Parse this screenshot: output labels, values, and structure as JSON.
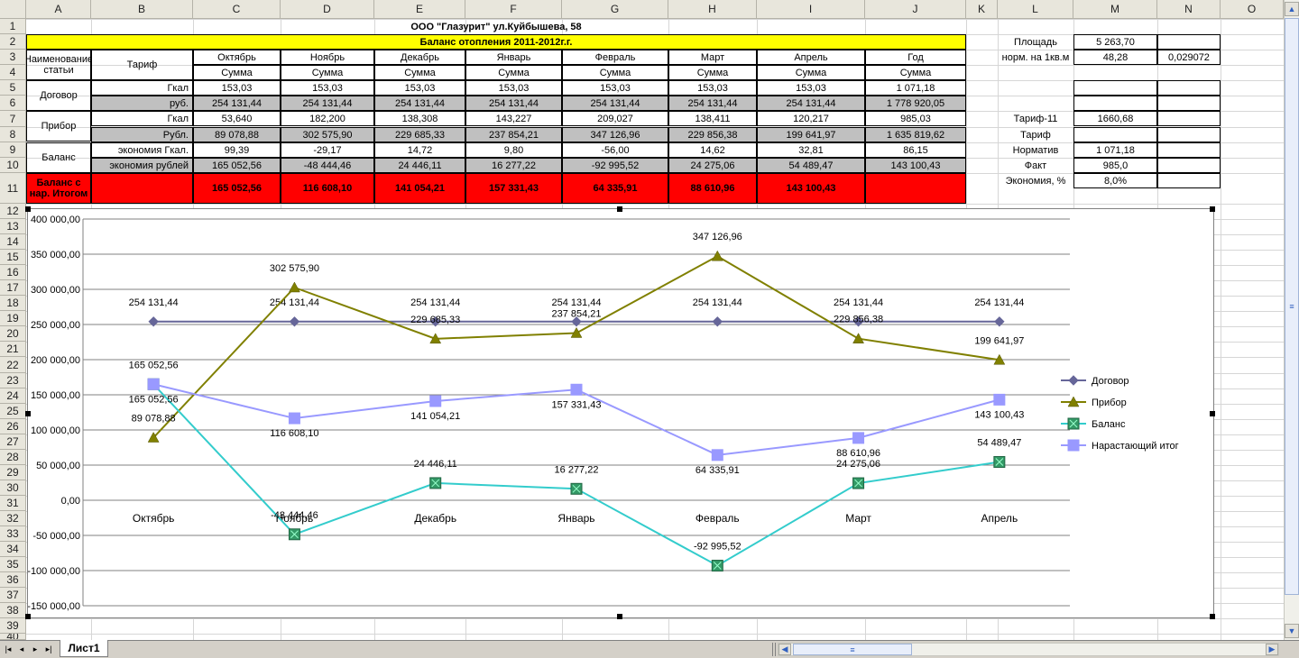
{
  "colors": {
    "header_bg": "#e8e6dc",
    "title_yellow": "#ffff00",
    "grey_row": "#c0c0c0",
    "red_row": "#ff0000",
    "dogovor": "#666699",
    "pribor": "#808000",
    "balans": "#33cccc",
    "itog": "#9999ff"
  },
  "columns": [
    "A",
    "B",
    "C",
    "D",
    "E",
    "F",
    "G",
    "H",
    "I",
    "J",
    "K",
    "L",
    "M",
    "N",
    "O"
  ],
  "rows": [
    "1",
    "2",
    "3",
    "4",
    "5",
    "6",
    "7",
    "8",
    "9",
    "10",
    "11",
    "12",
    "13",
    "14",
    "15",
    "16",
    "17",
    "18",
    "19",
    "20",
    "21",
    "22",
    "23",
    "24",
    "25",
    "26",
    "27",
    "28",
    "29",
    "30",
    "31",
    "32",
    "33",
    "34",
    "35",
    "36",
    "37",
    "38",
    "39",
    "40"
  ],
  "sheet": {
    "title": "ООО \"Глазурит\" ул.Куйбышева, 58",
    "subtitle": "Баланс отопления 2011-2012г.г.",
    "col_name": "Наименование статьи",
    "col_tariff": "Тариф",
    "months": [
      "Октябрь",
      "Ноябрь",
      "Декабрь",
      "Январь",
      "Февраль",
      "Март",
      "Апрель",
      "Год"
    ],
    "sum_label": "Сумма",
    "dogovor": {
      "label": "Договор",
      "gkal_label": "Гкал",
      "rub_label": "руб.",
      "gkal": [
        "153,03",
        "153,03",
        "153,03",
        "153,03",
        "153,03",
        "153,03",
        "153,03",
        "1 071,18"
      ],
      "rub": [
        "254 131,44",
        "254 131,44",
        "254 131,44",
        "254 131,44",
        "254 131,44",
        "254 131,44",
        "254 131,44",
        "1 778 920,05"
      ]
    },
    "pribor": {
      "label": "Прибор",
      "gkal_label": "Гкал",
      "rub_label": "Рубл.",
      "gkal": [
        "53,640",
        "182,200",
        "138,308",
        "143,227",
        "209,027",
        "138,411",
        "120,217",
        "985,03"
      ],
      "rub": [
        "89 078,88",
        "302 575,90",
        "229 685,33",
        "237 854,21",
        "347 126,96",
        "229 856,38",
        "199 641,97",
        "1 635 819,62"
      ]
    },
    "balans": {
      "label": "Баланс",
      "gkal_label": "экономия Гкал.",
      "rub_label": "экономия рублей",
      "gkal": [
        "99,39",
        "-29,17",
        "14,72",
        "9,80",
        "-56,00",
        "14,62",
        "32,81",
        "86,15"
      ],
      "rub": [
        "165 052,56",
        "-48 444,46",
        "24 446,11",
        "16 277,22",
        "-92 995,52",
        "24 275,06",
        "54 489,47",
        "143 100,43"
      ]
    },
    "itog": {
      "label": "Баланс с нар. Итогом",
      "values": [
        "165 052,56",
        "116 608,10",
        "141 054,21",
        "157 331,43",
        "64 335,91",
        "88 610,96",
        "143 100,43",
        ""
      ]
    },
    "side": [
      {
        "label": "Площадь",
        "value": "5 263,70",
        "extra": ""
      },
      {
        "label": "норм. на 1кв.м",
        "value": "48,28",
        "extra": "0,029072"
      },
      {
        "label": "Тариф-11",
        "value": "1660,68",
        "extra": ""
      },
      {
        "label": "Тариф",
        "value": "",
        "extra": ""
      },
      {
        "label": "Норматив",
        "value": "1 071,18",
        "extra": ""
      },
      {
        "label": "Факт",
        "value": "985,0",
        "extra": ""
      },
      {
        "label": "Экономия, %",
        "value": "8,0%",
        "extra": ""
      }
    ]
  },
  "tab": {
    "name": "Лист1"
  },
  "chart_data": {
    "type": "line",
    "categories": [
      "Октябрь",
      "Ноябрь",
      "Декабрь",
      "Январь",
      "Февраль",
      "Март",
      "Апрель"
    ],
    "ylim": [
      -150000,
      400000
    ],
    "ytick_step": 50000,
    "yticks": [
      "400 000,00",
      "350 000,00",
      "300 000,00",
      "250 000,00",
      "200 000,00",
      "150 000,00",
      "100 000,00",
      "50 000,00",
      "0,00",
      "-50 000,00",
      "-100 000,00",
      "-150 000,00"
    ],
    "legend_position": "right",
    "series": [
      {
        "name": "Договор",
        "color": "#666699",
        "marker": "diamond",
        "values": [
          254131.44,
          254131.44,
          254131.44,
          254131.44,
          254131.44,
          254131.44,
          254131.44
        ],
        "labels": [
          "254 131,44",
          "254 131,44",
          "254 131,44",
          "254 131,44",
          "254 131,44",
          "254 131,44",
          "254 131,44"
        ]
      },
      {
        "name": "Прибор",
        "color": "#808000",
        "marker": "triangle",
        "values": [
          89078.88,
          302575.9,
          229685.33,
          237854.21,
          347126.96,
          229856.38,
          199641.97
        ],
        "labels": [
          "89 078,88",
          "302 575,90",
          "229 685,33",
          "237 854,21",
          "347 126,96",
          "229 856,38",
          "199 641,97"
        ]
      },
      {
        "name": "Баланс",
        "color": "#33cccc",
        "marker": "square-x",
        "values": [
          165052.56,
          -48444.46,
          24446.11,
          16277.22,
          -92995.52,
          24275.06,
          54489.47
        ],
        "labels": [
          "165 052,56",
          "-48 444,46",
          "24 446,11",
          "16 277,22",
          "-92 995,52",
          "24 275,06",
          "54 489,47"
        ]
      },
      {
        "name": "Нарастающий итог",
        "color": "#9999ff",
        "marker": "square",
        "values": [
          165052.56,
          116608.1,
          141054.21,
          157331.43,
          64335.91,
          88610.96,
          143100.43
        ],
        "labels": [
          "165 052,56",
          "116 608,10",
          "141 054,21",
          "157 331,43",
          "64 335,91",
          "88 610,96",
          "143 100,43"
        ]
      }
    ]
  }
}
